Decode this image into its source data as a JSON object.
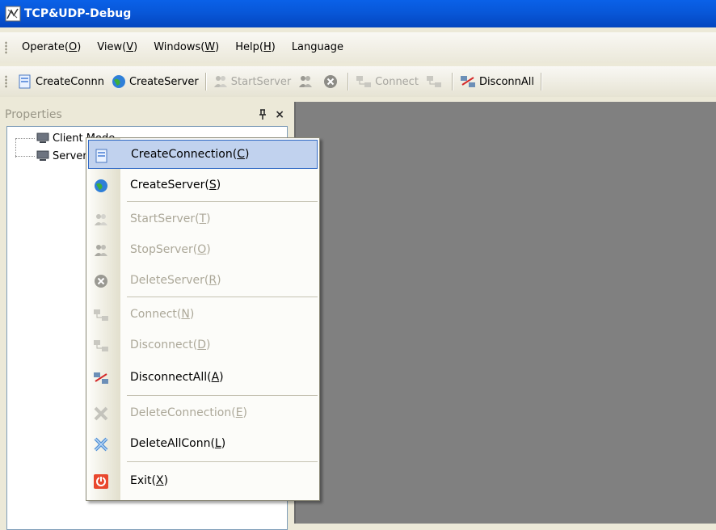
{
  "window": {
    "title": "TCP&UDP-Debug"
  },
  "menubar": {
    "items": [
      {
        "text": "Operate(",
        "key": "O",
        "end": ")"
      },
      {
        "text": "View(",
        "key": "V",
        "end": ")"
      },
      {
        "text": "Windows(",
        "key": "W",
        "end": ")"
      },
      {
        "text": "Help(",
        "key": "H",
        "end": ")"
      },
      {
        "text": "Language",
        "key": "",
        "end": ""
      }
    ]
  },
  "toolbar": {
    "create_conn": "CreateConnn",
    "create_server": "CreateServer",
    "start_server": "StartServer",
    "connect": "Connect",
    "disconn_all": "DisconnAll"
  },
  "properties": {
    "title": "Properties",
    "pin": "$",
    "close": "×",
    "tree": [
      "Client Mode",
      "Server Mode"
    ]
  },
  "context_menu": {
    "items": [
      {
        "text": "CreateConnection(",
        "key": "C",
        "end": ")",
        "icon": "create-connection-icon",
        "enabled": true,
        "highlight": true
      },
      {
        "text": "CreateServer(",
        "key": "S",
        "end": ")",
        "icon": "create-server-icon",
        "enabled": true
      },
      {
        "text": "StartServer(",
        "key": "T",
        "end": ")",
        "icon": "start-server-icon",
        "enabled": false
      },
      {
        "text": "StopServer(",
        "key": "O",
        "end": ")",
        "icon": "stop-server-icon",
        "enabled": false
      },
      {
        "text": "DeleteServer(",
        "key": "R",
        "end": ")",
        "icon": "delete-server-icon",
        "enabled": false
      },
      {
        "text": "Connect(",
        "key": "N",
        "end": ")",
        "icon": "connect-icon",
        "enabled": false
      },
      {
        "text": "Disconnect(",
        "key": "D",
        "end": ")",
        "icon": "disconnect-icon",
        "enabled": false
      },
      {
        "text": "DisconnectAll(",
        "key": "A",
        "end": ")",
        "icon": "disconnect-all-icon",
        "enabled": true
      },
      {
        "text": "DeleteConnection(",
        "key": "E",
        "end": ")",
        "icon": "delete-connection-icon",
        "enabled": false
      },
      {
        "text": "DeleteAllConn(",
        "key": "L",
        "end": ")",
        "icon": "delete-all-conn-icon",
        "enabled": true
      },
      {
        "text": "Exit(",
        "key": "X",
        "end": ")",
        "icon": "exit-icon",
        "enabled": true
      }
    ]
  },
  "colors": {
    "titlebar": "#0857d8",
    "workspace": "#808080",
    "highlight": "#c1d2ee"
  }
}
